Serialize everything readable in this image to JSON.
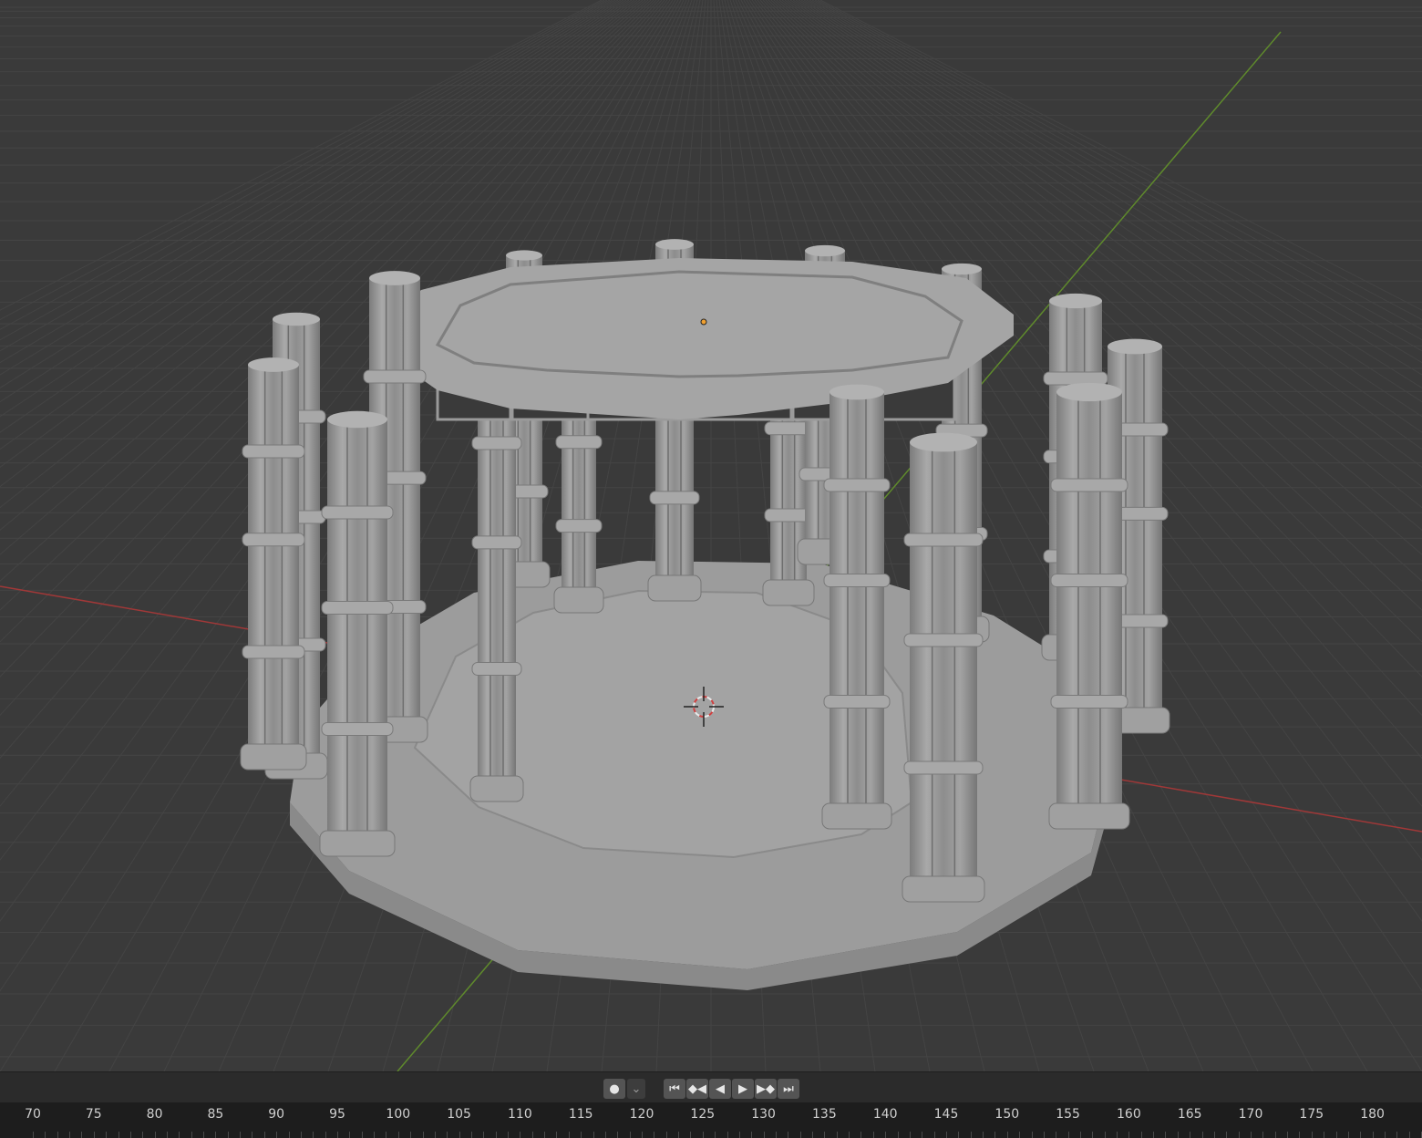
{
  "viewport": {
    "background": "#3a3a3a",
    "grid_color": "#444444",
    "x_axis_color": "#a03838",
    "y_axis_color": "#5f8a2c",
    "model_color": "#9b9b9b",
    "cursor_icon": "3d-cursor-icon",
    "origin_icon": "object-origin-icon"
  },
  "playback": {
    "keyframe_icon": "record-dot-icon",
    "dropdown_icon": "chevron-down-icon",
    "jump_start_icon": "jump-to-start-icon",
    "prev_key_icon": "previous-keyframe-icon",
    "play_reverse_icon": "play-reverse-icon",
    "play_icon": "play-icon",
    "next_key_icon": "next-keyframe-icon",
    "jump_end_icon": "jump-to-end-icon",
    "glyphs": {
      "record": "●",
      "dropdown": "⌄",
      "jump_start": "⏮",
      "prev_key": "◆◀",
      "reverse": "◀",
      "play": "▶",
      "next_key": "▶◆",
      "jump_end": "⏭"
    }
  },
  "timeline": {
    "frames": [
      "70",
      "75",
      "80",
      "85",
      "90",
      "95",
      "100",
      "105",
      "110",
      "115",
      "120",
      "125",
      "130",
      "135",
      "140",
      "145",
      "150",
      "155",
      "160",
      "165",
      "170",
      "175",
      "180"
    ]
  }
}
